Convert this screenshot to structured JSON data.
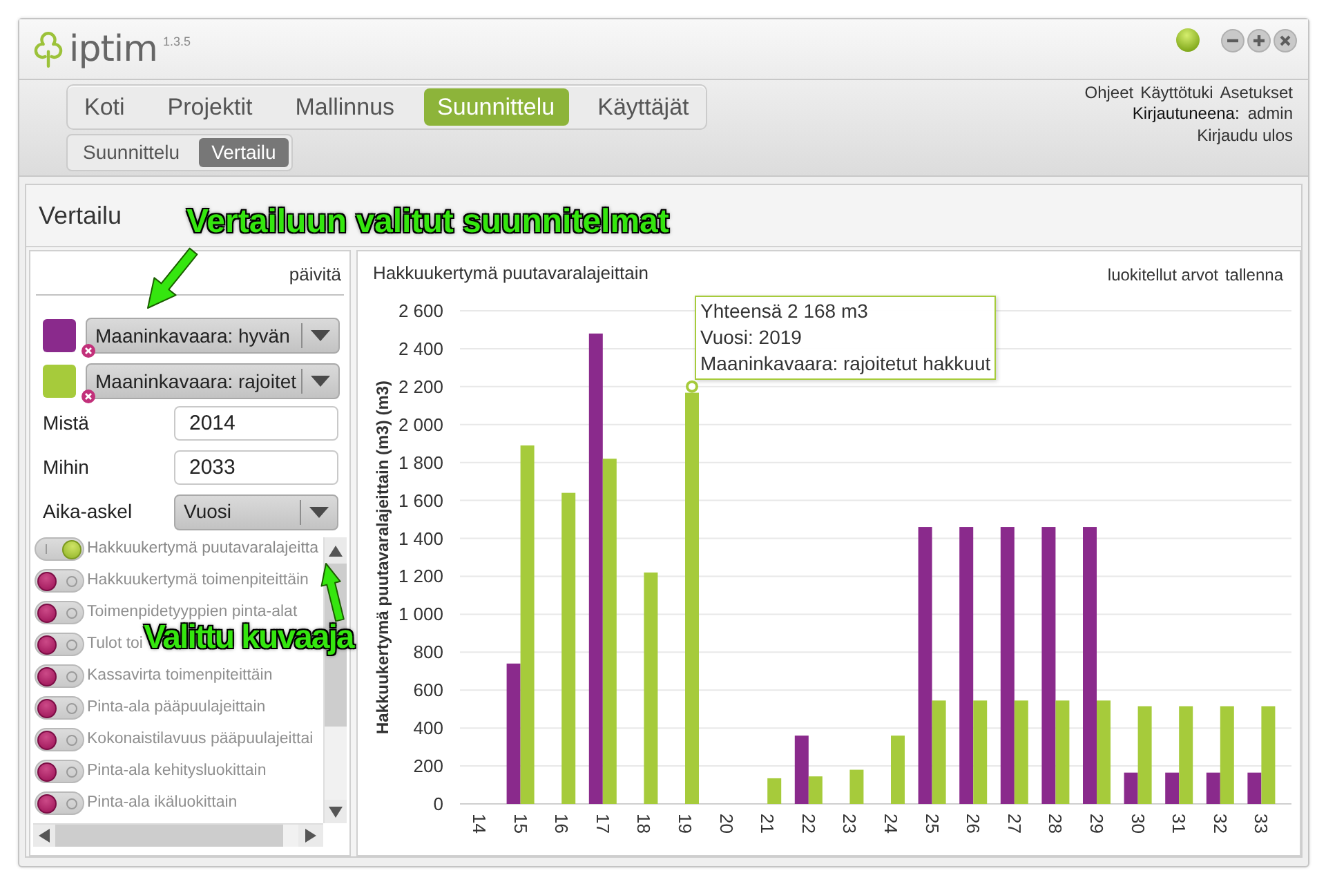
{
  "window": {
    "logo": "iptim",
    "version": "1.3.5"
  },
  "main_tabs": [
    {
      "label": "Koti",
      "selected": false
    },
    {
      "label": "Projektit",
      "selected": false
    },
    {
      "label": "Mallinnus",
      "selected": false
    },
    {
      "label": "Suunnittelu",
      "selected": true
    },
    {
      "label": "Käyttäjät",
      "selected": false
    }
  ],
  "sub_tabs": [
    {
      "label": "Suunnittelu",
      "selected": false
    },
    {
      "label": "Vertailu",
      "selected": true
    }
  ],
  "header_links": [
    "Ohjeet",
    "Käyttötuki",
    "Asetukset"
  ],
  "session": {
    "label": "Kirjautuneena:",
    "user": "admin",
    "logout": "Kirjaudu ulos"
  },
  "page": {
    "title": "Vertailu"
  },
  "comparison_panel": {
    "refresh": "päivitä",
    "plans": [
      {
        "color": "#8a2a8c",
        "name": "Maaninkavaara: hyvän"
      },
      {
        "color": "#a6cb3b",
        "name": "Maaninkavaara: rajoitet"
      }
    ],
    "fields": [
      {
        "kind": "input",
        "label": "Mistä",
        "value": "2014"
      },
      {
        "kind": "input",
        "label": "Mihin",
        "value": "2033"
      },
      {
        "kind": "select",
        "label": "Aika-askel",
        "value": "Vuosi"
      }
    ],
    "charts": [
      {
        "label": "Hakkuukertymä puutavaralajeitta",
        "selected": true
      },
      {
        "label": "Hakkuukertymä toimenpiteittäin",
        "selected": false
      },
      {
        "label": "Toimenpidetyyppien pinta-alat",
        "selected": false
      },
      {
        "label": "Tulot toi",
        "selected": false
      },
      {
        "label": "Kassavirta toimenpiteittäin",
        "selected": false
      },
      {
        "label": "Pinta-ala pääpuulajeittain",
        "selected": false
      },
      {
        "label": "Kokonaistilavuus pääpuulajeittai",
        "selected": false
      },
      {
        "label": "Pinta-ala kehitysluokittain",
        "selected": false
      },
      {
        "label": "Pinta-ala ikäluokittain",
        "selected": false
      }
    ]
  },
  "chart_panel": {
    "actions": [
      "luokitellut arvot",
      "tallenna"
    ],
    "chart_data": {
      "type": "bar",
      "title": "Hakkuukertymä puutavaralajeittain",
      "ylabel": "Hakkuukertymä puutavaralajeittain (m3) (m3)",
      "categories": [
        "14",
        "15",
        "16",
        "17",
        "18",
        "19",
        "20",
        "21",
        "22",
        "23",
        "24",
        "25",
        "26",
        "27",
        "28",
        "29",
        "30",
        "31",
        "32",
        "33"
      ],
      "series": [
        {
          "color": "#8a2a8c",
          "values": [
            0,
            740,
            0,
            2480,
            0,
            0,
            0,
            0,
            360,
            0,
            0,
            1460,
            1460,
            1460,
            1460,
            1460,
            165,
            165,
            165,
            165
          ]
        },
        {
          "color": "#a6cb3b",
          "values": [
            0,
            1890,
            1640,
            1820,
            1220,
            2168,
            0,
            135,
            145,
            180,
            360,
            545,
            545,
            545,
            545,
            545,
            515,
            515,
            515,
            515
          ]
        }
      ],
      "ylim": [
        0,
        2600
      ],
      "yticks": [
        0,
        200,
        400,
        600,
        800,
        {
          "value": 1000,
          "label": "1 000"
        },
        {
          "value": 1200,
          "label": "1 200"
        },
        {
          "value": 1400,
          "label": "1 400"
        },
        {
          "value": 1600,
          "label": "1 600"
        },
        {
          "value": 1800,
          "label": "1 800"
        },
        {
          "value": 2000,
          "label": "2 000"
        },
        {
          "value": 2200,
          "label": "2 200"
        },
        {
          "value": 2400,
          "label": "2 400"
        },
        {
          "value": 2600,
          "label": "2 600"
        }
      ],
      "grid": true
    },
    "tooltip": {
      "lines": [
        "Yhteensä 2 168 m3",
        "Vuosi: 2019",
        "Maaninkavaara: rajoitetut hakkuut"
      ]
    }
  },
  "annotations": [
    {
      "text": "Vertailuun valitut suunnitelmat"
    },
    {
      "text": "Valittu kuvaaja"
    }
  ]
}
